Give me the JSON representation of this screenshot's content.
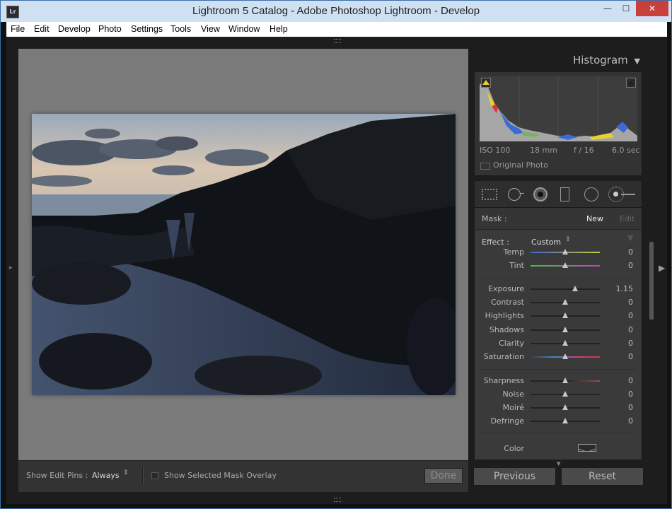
{
  "window": {
    "title": "Lightroom 5 Catalog - Adobe Photoshop Lightroom - Develop",
    "app_icon_text": "Lr",
    "min_glyph": "—",
    "max_glyph": "☐",
    "close_glyph": "✕"
  },
  "menu": [
    "File",
    "Edit",
    "Develop",
    "Photo",
    "Settings",
    "Tools",
    "View",
    "Window",
    "Help"
  ],
  "toolbar": {
    "show_edit_pins_label": "Show Edit Pins :",
    "show_edit_pins_value": "Always",
    "show_mask_overlay_label": "Show Selected Mask Overlay",
    "done_label": "Done"
  },
  "histogram": {
    "title": "Histogram",
    "iso": "ISO 100",
    "focal": "18 mm",
    "aperture": "f / 16",
    "shutter": "6.0 sec",
    "original_photo_label": "Original Photo"
  },
  "mask": {
    "label": "Mask :",
    "new_label": "New",
    "edit_label": "Edit"
  },
  "effect": {
    "label": "Effect :",
    "value": "Custom"
  },
  "sliders": [
    {
      "id": "temp",
      "label": "Temp",
      "value": "0",
      "position": 0.5,
      "gradient": "linear-gradient(90deg,#3c62c8,#c8c83c)"
    },
    {
      "id": "tint",
      "label": "Tint",
      "value": "0",
      "position": 0.5,
      "gradient": "linear-gradient(90deg,#3cc83c,#c83cc8)"
    },
    {
      "id": "exposure",
      "label": "Exposure",
      "value": "1.15",
      "position": 0.64,
      "gradient": ""
    },
    {
      "id": "contrast",
      "label": "Contrast",
      "value": "0",
      "position": 0.5,
      "gradient": ""
    },
    {
      "id": "highlights",
      "label": "Highlights",
      "value": "0",
      "position": 0.5,
      "gradient": ""
    },
    {
      "id": "shadows",
      "label": "Shadows",
      "value": "0",
      "position": 0.5,
      "gradient": ""
    },
    {
      "id": "clarity",
      "label": "Clarity",
      "value": "0",
      "position": 0.5,
      "gradient": ""
    },
    {
      "id": "saturation",
      "label": "Saturation",
      "value": "0",
      "position": 0.5,
      "gradient": "linear-gradient(90deg,#3a3a3a,#3c8cc8,#c83c8c,#c83c3c)"
    },
    {
      "id": "sharpness",
      "label": "Sharpness",
      "value": "0",
      "position": 0.5,
      "gradient": "linear-gradient(90deg,#222 50%,#a04a4a)"
    },
    {
      "id": "noise",
      "label": "Noise",
      "value": "0",
      "position": 0.5,
      "gradient": ""
    },
    {
      "id": "moire",
      "label": "Moiré",
      "value": "0",
      "position": 0.5,
      "gradient": ""
    },
    {
      "id": "defringe",
      "label": "Defringe",
      "value": "0",
      "position": 0.5,
      "gradient": ""
    }
  ],
  "color_label": "Color",
  "buttons": {
    "previous": "Previous",
    "reset": "Reset"
  }
}
